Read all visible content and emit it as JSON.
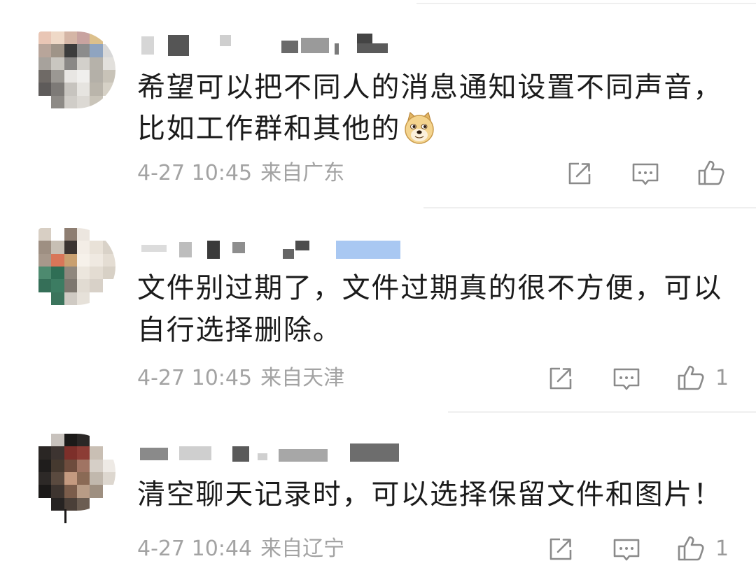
{
  "comments": [
    {
      "body": [
        "希望可以把不同人的消息通知设置不同声音，",
        "比如工作群和其他的"
      ],
      "emoji": "doge-emoji",
      "time": "4-27 10:45",
      "source": "来自广东"
    },
    {
      "body": [
        "文件别过期了，文件过期真的很不方便，可以",
        "自行选择删除。"
      ],
      "time": "4-27 10:45",
      "source": "来自天津",
      "like_count": "1"
    },
    {
      "body": [
        "清空聊天记录时，可以选择保留文件和图片！"
      ],
      "time": "4-27 10:44",
      "source": "来自辽宁",
      "like_count": "1"
    }
  ],
  "icons": {
    "share": "share-icon",
    "comment": "comment-icon",
    "like": "like-icon",
    "emoji": "doge-emoji-icon"
  },
  "colors": {
    "text": "#1b1b1b",
    "meta": "#a3a3a3",
    "icon": "#8a8a8a",
    "divider": "#efefef",
    "badge": "#a9c8f2"
  }
}
